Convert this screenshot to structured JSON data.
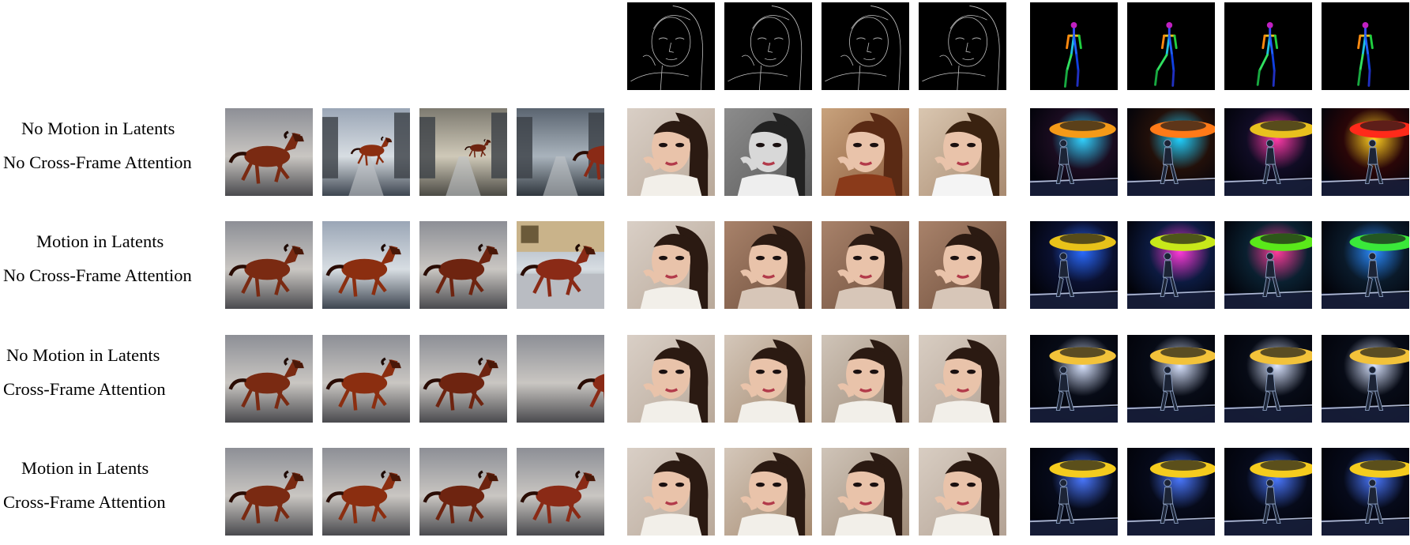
{
  "figure": {
    "row_labels": [
      {
        "line1": "No Motion in Latents",
        "line2": "No Cross-Frame Attention"
      },
      {
        "line1": "Motion in Latents",
        "line2": "No Cross-Frame Attention"
      },
      {
        "line1": "No Motion in Latents",
        "line2": "Cross-Frame Attention"
      },
      {
        "line1": "Motion in Latents",
        "line2": "Cross-Frame Attention"
      }
    ],
    "groups": [
      {
        "subject": "horse",
        "condition": "none"
      },
      {
        "subject": "portrait",
        "condition": "edge-map"
      },
      {
        "subject": "dancer",
        "condition": "pose-skeleton"
      }
    ]
  }
}
